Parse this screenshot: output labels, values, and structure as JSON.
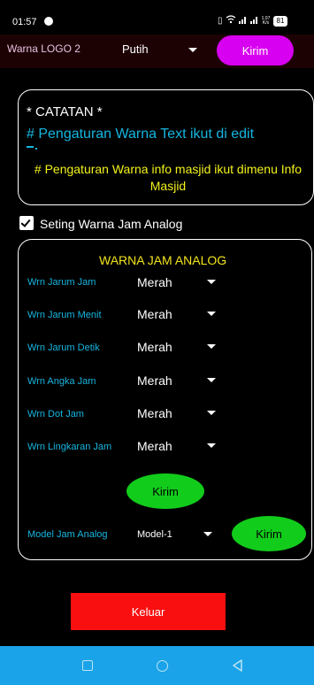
{
  "status_bar": {
    "time": "01:57",
    "net_speed": "1.07 K/s",
    "battery": "81"
  },
  "logo": {
    "label": "Warna LOGO 2",
    "selected": "Putih",
    "send_label": "Kirim",
    "send_color": "#d800f0"
  },
  "notes": {
    "title": "* CATATAN *",
    "line1": "# Pengaturan Warna Text ikut di edit",
    "line2": "# Pengaturan Warna info masjid ikut dimenu Info Masjid"
  },
  "checkbox": {
    "label": "Seting Warna Jam Analog",
    "checked": true
  },
  "analog": {
    "title": "WARNA JAM ANALOG",
    "rows": [
      {
        "label": "Wrn Jarum Jam",
        "value": "Merah"
      },
      {
        "label": "Wrn Jarum Menit",
        "value": "Merah"
      },
      {
        "label": "Wrn Jarum Detik",
        "value": "Merah"
      },
      {
        "label": "Wrn Angka Jam",
        "value": "Merah"
      },
      {
        "label": "Wrn Dot Jam",
        "value": "Merah"
      },
      {
        "label": "Wrn Lingkaran Jam",
        "value": "Merah"
      }
    ],
    "send_label": "Kirim",
    "model_label": "Model Jam Analog",
    "model_value": "Model-1",
    "model_send_label": "Kirim",
    "send_color": "#12cc1c"
  },
  "exit_label": "Keluar",
  "exit_color": "#f90f0f",
  "nav_bar": {
    "color": "#1aa3e8",
    "icons": [
      "square-recents-icon",
      "circle-home-icon",
      "triangle-back-icon"
    ]
  }
}
